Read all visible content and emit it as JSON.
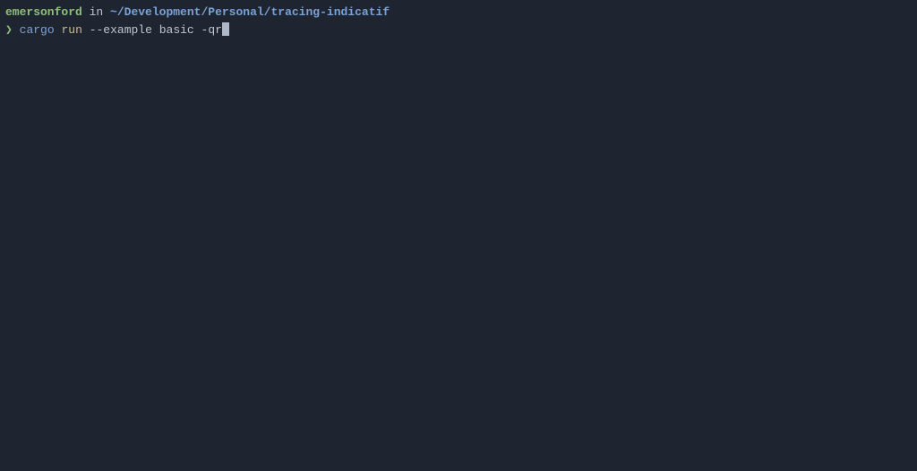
{
  "prompt": {
    "user": "emersonford",
    "in_text": " in ",
    "path": "~/Development/Personal/tracing-indicatif",
    "symbol": "❯",
    "command": "cargo",
    "subcommand": "run",
    "flag1": "--example",
    "arg1": "basic",
    "flag2": "-qr"
  }
}
